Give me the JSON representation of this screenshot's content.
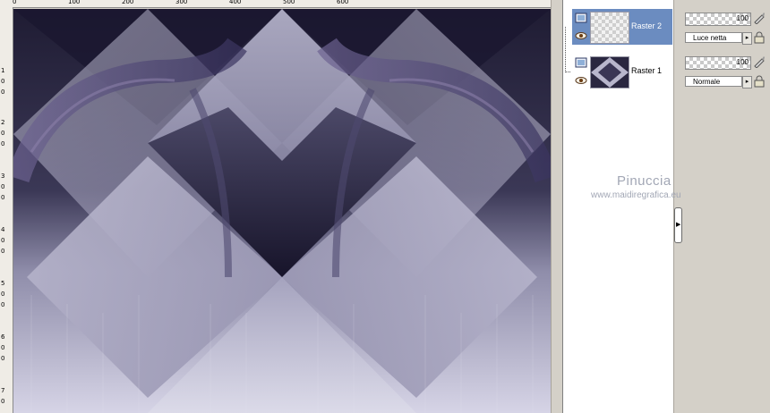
{
  "ruler": {
    "top_labels": [
      "0",
      "100",
      "200",
      "300",
      "400",
      "500",
      "600"
    ],
    "left_labels": [
      "1",
      "0",
      "0",
      "2",
      "0",
      "0",
      "3",
      "0",
      "0",
      "4",
      "0",
      "0",
      "5",
      "0",
      "0",
      "6",
      "0",
      "0",
      "7",
      "0"
    ]
  },
  "layers": [
    {
      "name": "Raster 2",
      "selected": true,
      "visible_icon": "layer-raster-icon"
    },
    {
      "name": "Raster 1",
      "selected": false,
      "visible_icon": "eye-icon"
    }
  ],
  "properties": [
    {
      "opacity": "100",
      "blend_mode": "Luce netta"
    },
    {
      "opacity": "100",
      "blend_mode": "Normale"
    }
  ],
  "watermark": {
    "title": "Pinuccia",
    "url": "www.maidiregrafica.eu"
  },
  "colors": {
    "selection": "#6b8cc0",
    "panel_bg": "#d4d0c8",
    "canvas_dark": "#2a2740",
    "canvas_light": "#c9c7dc"
  }
}
